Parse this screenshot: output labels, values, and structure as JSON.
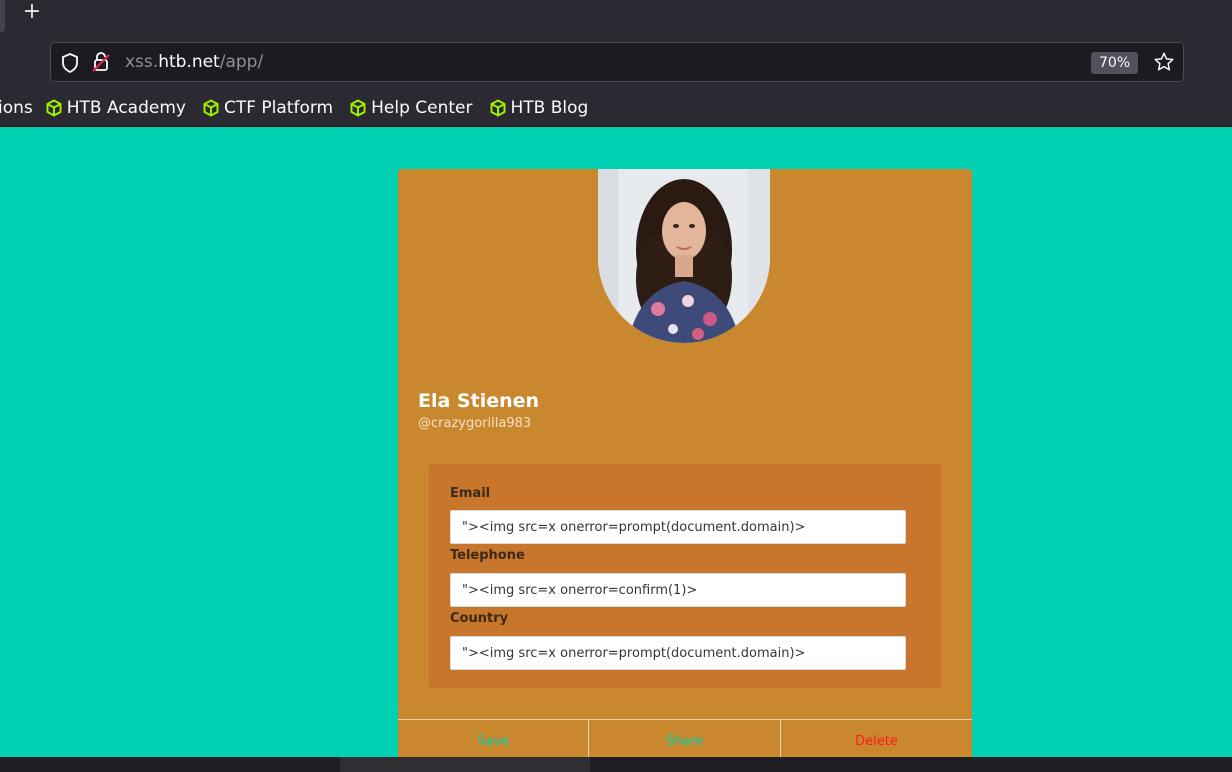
{
  "browser": {
    "new_tab_label": "+",
    "url": {
      "host_prefix": "xss.",
      "host": "htb.net",
      "path": "/app/"
    },
    "zoom": "70%",
    "bookmarks": [
      {
        "label": "HTB Academy",
        "icon": "cube-icon"
      },
      {
        "label": "CTF Platform",
        "icon": "cube-icon"
      },
      {
        "label": "Help Center",
        "icon": "cube-icon"
      },
      {
        "label": "HTB Blog",
        "icon": "cube-icon"
      }
    ],
    "bookmark_cut_label": "ions",
    "bookmark_icon_color": "#9fef00"
  },
  "profile": {
    "name": "Ela Stienen",
    "handle": "@crazygorilla983",
    "fields": {
      "email": {
        "label": "Email",
        "value": "\"><img src=x onerror=prompt(document.domain)>"
      },
      "telephone": {
        "label": "Telephone",
        "value": "\"><img src=x onerror=confirm(1)>"
      },
      "country": {
        "label": "Country",
        "value": "\"><img src=x onerror=prompt(document.domain)>"
      }
    }
  },
  "actions": {
    "save": "Save",
    "share": "Share",
    "delete": "Delete"
  },
  "colors": {
    "page_background": "#00d1b2",
    "card": "#c9872e",
    "info_box": "#c7762c",
    "delete": "#ff1a1a"
  }
}
